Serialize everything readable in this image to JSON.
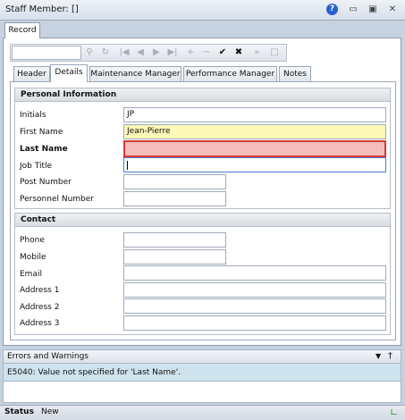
{
  "window": {
    "title": "Staff Member: []"
  },
  "icons": {
    "help": "help-icon",
    "restore": "restore-icon",
    "maximize": "maximize-icon",
    "close": "close-icon"
  },
  "outer_tab": "Record",
  "toolbar": {
    "record_value": ""
  },
  "inner_tabs": [
    "Header",
    "Details",
    "Maintenance Manager",
    "Performance Manager",
    "Notes"
  ],
  "active_tab": "Details",
  "personal": {
    "heading": "Personal Information",
    "initials_label": "Initials",
    "initials_value": "JP",
    "first_label": "First Name",
    "first_value": "Jean-Pierre",
    "last_label": "Last Name",
    "last_value": "",
    "job_label": "Job Title",
    "job_value": "",
    "post_label": "Post Number",
    "post_value": "",
    "personnel_label": "Personnel Number",
    "personnel_value": ""
  },
  "contact": {
    "heading": "Contact",
    "phone_label": "Phone",
    "mobile_label": "Mobile",
    "email_label": "Email",
    "addr1_label": "Address 1",
    "addr2_label": "Address 2",
    "addr3_label": "Address 3"
  },
  "errors": {
    "title": "Errors and Warnings",
    "message": "E5040: Value not specified for 'Last Name'."
  },
  "status": {
    "label": "Status",
    "value": "New"
  }
}
